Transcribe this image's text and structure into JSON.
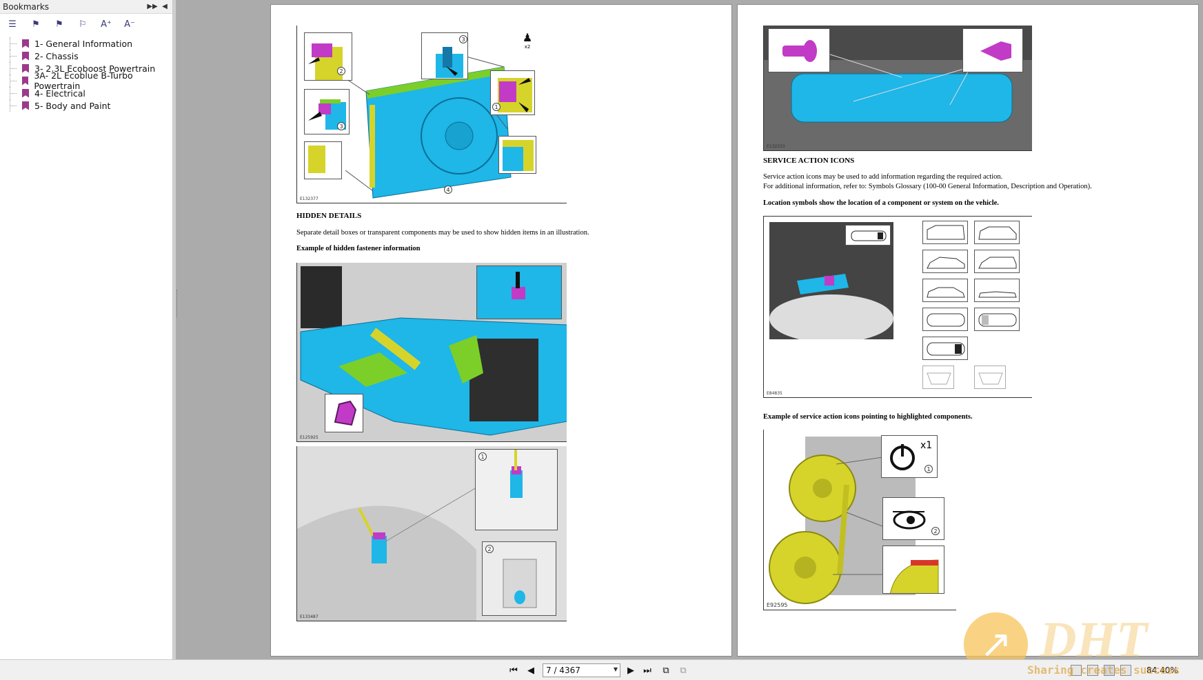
{
  "sidebar": {
    "title": "Bookmarks",
    "toolbar_icons": [
      "list-options-icon",
      "bookmark-expand-icon",
      "bookmark-collapse-icon",
      "bookmark-find-icon",
      "font-larger-icon",
      "font-smaller-icon"
    ],
    "font_larger": "A⁺",
    "font_smaller": "A⁻",
    "items": [
      {
        "label": "1- General Information"
      },
      {
        "label": "2- Chassis"
      },
      {
        "label": "3- 2.3L Ecoboost Powertrain"
      },
      {
        "label": "3A- 2L Ecoblue B-Turbo Powertrain"
      },
      {
        "label": "4- Electrical"
      },
      {
        "label": "5- Body and Paint"
      }
    ]
  },
  "left_page": {
    "fig1_code": "E132377",
    "hidden_heading": "HIDDEN DETAILS",
    "hidden_text": "Separate detail boxes or transparent components may be used to show hidden items in an illustration.",
    "fastener_heading": "Example of hidden fastener information",
    "fig2_code": "E125925",
    "fig3_code": "E133487",
    "person_qty": "x2",
    "callouts_fig1": [
      "1",
      "2",
      "3",
      "3",
      "4"
    ],
    "callouts_fig3": [
      "1",
      "2"
    ]
  },
  "right_page": {
    "fig1_code": "E132233",
    "service_heading": "SERVICE ACTION ICONS",
    "service_text_1": "Service action icons may be used to add information regarding the required action.",
    "service_text_2": "For additional information, refer to: Symbols Glossary (100-00 General Information, Description and Operation).",
    "location_heading": "Location symbols show the location of a component or system on the vehicle.",
    "fig2_code": "E84835",
    "example_heading": "Example of service action icons pointing to highlighted components.",
    "fig3_code": "E92595",
    "rotate_qty": "x1",
    "callouts_fig3": [
      "1",
      "2"
    ]
  },
  "bottombar": {
    "page_value": "7 / 4367",
    "zoom": "84.40%"
  },
  "watermark": {
    "logo": "DHT",
    "tagline": "Sharing creates success"
  },
  "colors": {
    "component_blue": "#1fb6e8",
    "highlight_magenta": "#c13bc7",
    "highlight_yellow": "#d6d42a",
    "highlight_green": "#7ccf28",
    "bookmark_flag": "#9b3a8a"
  }
}
